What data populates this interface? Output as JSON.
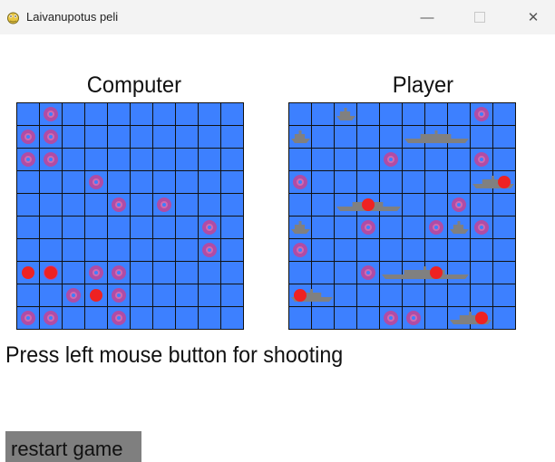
{
  "window": {
    "title": "Laivanupotus peli",
    "minimize_glyph": "—",
    "close_glyph": "✕"
  },
  "computer_board": {
    "title": "Computer",
    "size": 10,
    "misses": [
      [
        1,
        0
      ],
      [
        2,
        0
      ],
      [
        0,
        1
      ],
      [
        1,
        1
      ],
      [
        2,
        1
      ],
      [
        3,
        3
      ],
      [
        4,
        4
      ],
      [
        4,
        6
      ],
      [
        5,
        8
      ],
      [
        6,
        8
      ],
      [
        7,
        1
      ],
      [
        7,
        3
      ],
      [
        7,
        4
      ],
      [
        8,
        2
      ],
      [
        8,
        4
      ],
      [
        9,
        0
      ],
      [
        9,
        1
      ],
      [
        9,
        4
      ]
    ],
    "hits": [
      [
        7,
        0
      ],
      [
        7,
        1
      ],
      [
        8,
        3
      ]
    ]
  },
  "player_board": {
    "title": "Player",
    "size": 10,
    "ships": [
      {
        "length": 1,
        "row": 0,
        "col": 2
      },
      {
        "length": 1,
        "row": 1,
        "col": 0
      },
      {
        "length": 3,
        "row": 1,
        "col": 5
      },
      {
        "length": 2,
        "row": 3,
        "col": 8
      },
      {
        "length": 3,
        "row": 4,
        "col": 2
      },
      {
        "length": 1,
        "row": 5,
        "col": 0
      },
      {
        "length": 1,
        "row": 5,
        "col": 7
      },
      {
        "length": 4,
        "row": 7,
        "col": 4
      },
      {
        "length": 2,
        "row": 8,
        "col": 0
      },
      {
        "length": 2,
        "row": 9,
        "col": 7
      }
    ],
    "misses": [
      [
        0,
        8
      ],
      [
        2,
        4
      ],
      [
        2,
        8
      ],
      [
        3,
        0
      ],
      [
        4,
        7
      ],
      [
        5,
        3
      ],
      [
        5,
        6
      ],
      [
        5,
        8
      ],
      [
        6,
        0
      ],
      [
        7,
        3
      ],
      [
        9,
        4
      ],
      [
        9,
        5
      ]
    ],
    "hits": [
      [
        3,
        9
      ],
      [
        4,
        3
      ],
      [
        7,
        6
      ],
      [
        8,
        0
      ],
      [
        9,
        8
      ]
    ]
  },
  "instruction_text": "Press left mouse button for shooting",
  "restart_button_label": "restart game",
  "colors": {
    "water": "#3d80ff",
    "grid": "#111111",
    "ship": "#808080",
    "miss": "#b04ca5",
    "hit": "#ee2222",
    "button": "#7f7f7f"
  }
}
